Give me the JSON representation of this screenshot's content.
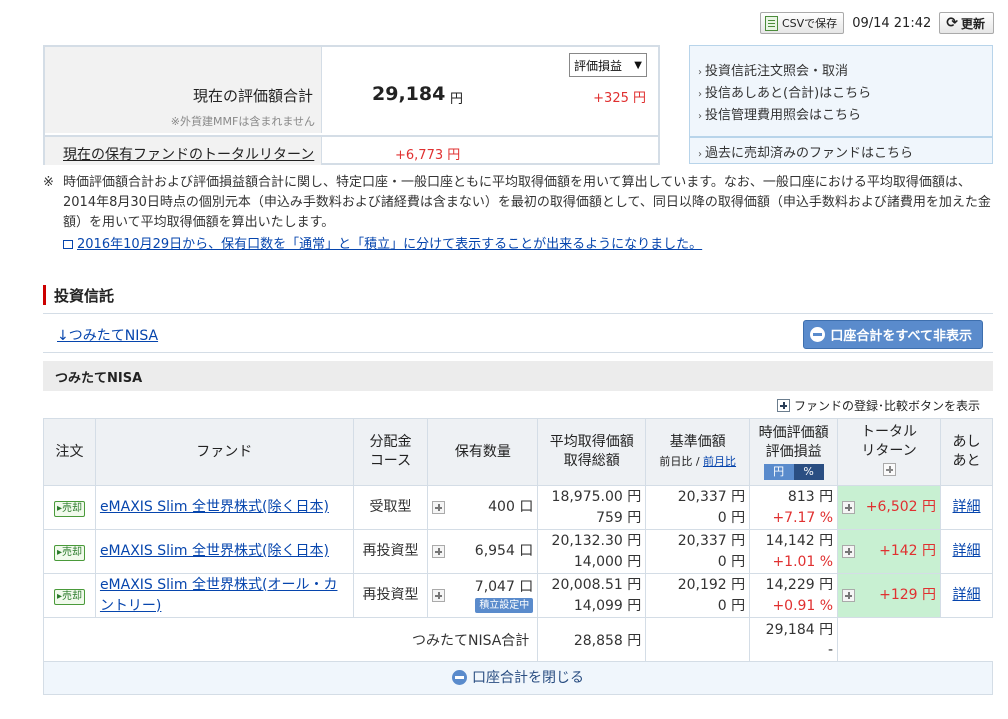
{
  "topbar": {
    "csv_label": "CSVで保存",
    "datetime": "09/14 21:42",
    "refresh_label": "更新"
  },
  "summary": {
    "label": "現在の評価額合計",
    "note": "※外貨建MMFは含まれません",
    "value": "29,184",
    "unit": "円",
    "select_value": "評価損益",
    "pl": "+325 円",
    "return_label": "現在の保有ファンドのトータルリターン",
    "return_value": "+6,773 円"
  },
  "links": {
    "items": [
      "投資信託注文照会・取消",
      "投信あしあと(合計)はこちら",
      "投信管理費用照会はこちら"
    ],
    "sold": "過去に売却済みのファンドはこちら"
  },
  "notes": {
    "mark": "※",
    "text": "時価評価額合計および評価損益額合計に関し、特定口座・一般口座ともに平均取得価額を用いて算出しています。なお、一般口座における平均取得価額は、2014年8月30日時点の個別元本（申込み手数料および諸経費は含まない）を最初の取得価額として、同日以降の取得価額（申込手数料および諸費用を加えた金額）を用いて平均取得価額を算出いたします。",
    "link": "2016年10月29日から、保有口数を「通常」と「積立」に分けて表示することが出来るようになりました。"
  },
  "section": {
    "title": "投資信託",
    "nav_link": "↓つみたてNISA",
    "hide_all_label": "口座合計をすべて非表示",
    "group_title": "つみたてNISA",
    "add_compare_label": "ファンドの登録･比較ボタンを表示"
  },
  "table": {
    "headers": {
      "order": "注文",
      "fund": "ファンド",
      "dist1": "分配金",
      "dist2": "コース",
      "qty": "保有数量",
      "avg1": "平均取得価額",
      "avg2": "取得総額",
      "base1": "基準価額",
      "base2a": "前日比",
      "base2b": "前月比",
      "eval1": "時価評価額",
      "eval2": "評価損益",
      "tab_yen": "円",
      "tab_pct": "%",
      "ret1": "トータル",
      "ret2": "リターン",
      "ashi1": "あし",
      "ashi2": "あと"
    },
    "rows": [
      {
        "sell": "売却",
        "fund": "eMAXIS Slim 全世界株式(除く日本)",
        "course": "受取型",
        "qty": "400 口",
        "badge": "",
        "avg": "18,975.00 円",
        "total": "759 円",
        "base": "20,337 円",
        "base_diff": "0 円",
        "eval": "813 円",
        "eval_pl": "+7.17 %",
        "ret": "+6,502 円",
        "detail": "詳細"
      },
      {
        "sell": "売却",
        "fund": "eMAXIS Slim 全世界株式(除く日本)",
        "course": "再投資型",
        "qty": "6,954 口",
        "badge": "",
        "avg": "20,132.30 円",
        "total": "14,000 円",
        "base": "20,337 円",
        "base_diff": "0 円",
        "eval": "14,142 円",
        "eval_pl": "+1.01 %",
        "ret": "+142 円",
        "detail": "詳細"
      },
      {
        "sell": "売却",
        "fund": "eMAXIS Slim 全世界株式(オール・カントリー)",
        "course": "再投資型",
        "qty": "7,047 口",
        "badge": "積立設定中",
        "avg": "20,008.51 円",
        "total": "14,099 円",
        "base": "20,192 円",
        "base_diff": "0 円",
        "eval": "14,229 円",
        "eval_pl": "+0.91 %",
        "ret": "+129 円",
        "detail": "詳細"
      }
    ],
    "total_label": "つみたてNISA合計",
    "total_cost": "28,858 円",
    "total_eval": "29,184 円",
    "total_pl": "-",
    "close_label": "口座合計を閉じる"
  }
}
